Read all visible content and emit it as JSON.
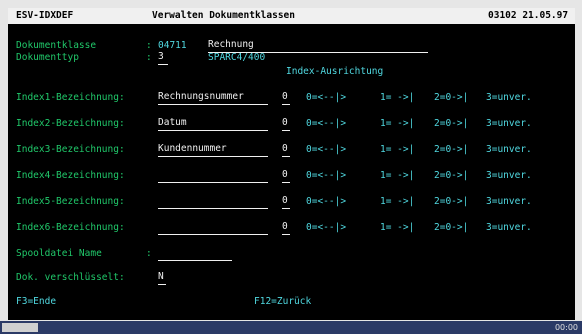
{
  "header": {
    "left": "ESV-IDXDEF",
    "center": "Verwalten Dokumentklassen",
    "right": "03102 21.05.97"
  },
  "meta": {
    "klasse_label": "Dokumentklasse",
    "klasse_colon": ":",
    "klasse_code": "04711",
    "klasse_value": "Rechnung",
    "typ_label": "Dokumenttyp",
    "typ_colon": ":",
    "typ_value": "3",
    "typ_desc": "SPARC4/400",
    "index_title": "Index-Ausrichtung"
  },
  "options": {
    "dash": "0=<--|>",
    "right": "1= ->|",
    "both": "2=0->|",
    "unchanged": "3=unver."
  },
  "indexes": [
    {
      "label": "Index1-Bezeichnung:",
      "value": "Rechnungsnummer",
      "align": "0"
    },
    {
      "label": "Index2-Bezeichnung:",
      "value": "Datum",
      "align": "0"
    },
    {
      "label": "Index3-Bezeichnung:",
      "value": "Kundennummer",
      "align": "0"
    },
    {
      "label": "Index4-Bezeichnung:",
      "value": "",
      "align": "0"
    },
    {
      "label": "Index5-Bezeichnung:",
      "value": "",
      "align": "0"
    },
    {
      "label": "Index6-Bezeichnung:",
      "value": "",
      "align": "0"
    }
  ],
  "spool": {
    "label": "Spooldatei Name",
    "colon": ":",
    "value": ""
  },
  "encrypted": {
    "label": "Dok. verschlüsselt:",
    "value": "N"
  },
  "footer": {
    "f3": "F3=Ende",
    "f12": "F12=Zurück"
  },
  "taskbar": {
    "clock": "00:00"
  }
}
